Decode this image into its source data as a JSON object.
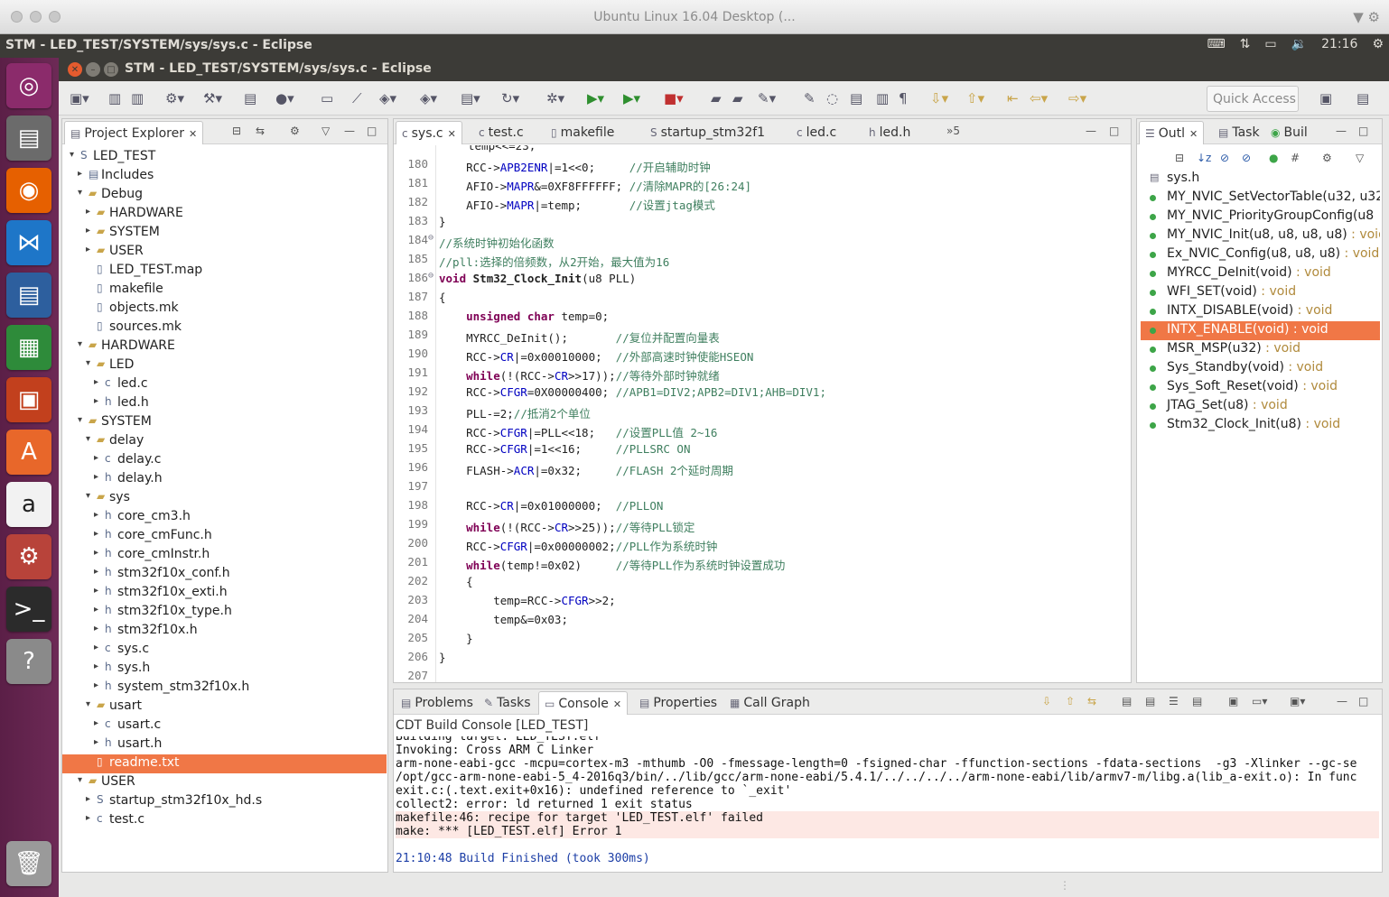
{
  "vm": {
    "title": "Ubuntu Linux 16.04 Desktop (...",
    "right_icons": "▼ ⚙"
  },
  "topbar": {
    "app_title": "STM - LED_TEST/SYSTEM/sys/sys.c - Eclipse",
    "clock": "21:16"
  },
  "window": {
    "title": "STM - LED_TEST/SYSTEM/sys/sys.c - Eclipse",
    "quick_access": "Quick Access"
  },
  "explorer": {
    "tab_label": "Project Explorer",
    "rows": [
      {
        "label": "LED_TEST",
        "depth": 0,
        "arrow": "▾",
        "icon": "S"
      },
      {
        "label": "Includes",
        "depth": 1,
        "arrow": "▸",
        "icon": "▤"
      },
      {
        "label": "Debug",
        "depth": 1,
        "arrow": "▾",
        "icon": "▰"
      },
      {
        "label": "HARDWARE",
        "depth": 2,
        "arrow": "▸",
        "icon": "▰"
      },
      {
        "label": "SYSTEM",
        "depth": 2,
        "arrow": "▸",
        "icon": "▰"
      },
      {
        "label": "USER",
        "depth": 2,
        "arrow": "▸",
        "icon": "▰"
      },
      {
        "label": "LED_TEST.map",
        "depth": 2,
        "arrow": "",
        "icon": "▯"
      },
      {
        "label": "makefile",
        "depth": 2,
        "arrow": "",
        "icon": "▯"
      },
      {
        "label": "objects.mk",
        "depth": 2,
        "arrow": "",
        "icon": "▯"
      },
      {
        "label": "sources.mk",
        "depth": 2,
        "arrow": "",
        "icon": "▯"
      },
      {
        "label": "HARDWARE",
        "depth": 1,
        "arrow": "▾",
        "icon": "▰"
      },
      {
        "label": "LED",
        "depth": 2,
        "arrow": "▾",
        "icon": "▰"
      },
      {
        "label": "led.c",
        "depth": 3,
        "arrow": "▸",
        "icon": "c"
      },
      {
        "label": "led.h",
        "depth": 3,
        "arrow": "▸",
        "icon": "h"
      },
      {
        "label": "SYSTEM",
        "depth": 1,
        "arrow": "▾",
        "icon": "▰"
      },
      {
        "label": "delay",
        "depth": 2,
        "arrow": "▾",
        "icon": "▰"
      },
      {
        "label": "delay.c",
        "depth": 3,
        "arrow": "▸",
        "icon": "c"
      },
      {
        "label": "delay.h",
        "depth": 3,
        "arrow": "▸",
        "icon": "h"
      },
      {
        "label": "sys",
        "depth": 2,
        "arrow": "▾",
        "icon": "▰"
      },
      {
        "label": "core_cm3.h",
        "depth": 3,
        "arrow": "▸",
        "icon": "h"
      },
      {
        "label": "core_cmFunc.h",
        "depth": 3,
        "arrow": "▸",
        "icon": "h"
      },
      {
        "label": "core_cmInstr.h",
        "depth": 3,
        "arrow": "▸",
        "icon": "h"
      },
      {
        "label": "stm32f10x_conf.h",
        "depth": 3,
        "arrow": "▸",
        "icon": "h"
      },
      {
        "label": "stm32f10x_exti.h",
        "depth": 3,
        "arrow": "▸",
        "icon": "h"
      },
      {
        "label": "stm32f10x_type.h",
        "depth": 3,
        "arrow": "▸",
        "icon": "h"
      },
      {
        "label": "stm32f10x.h",
        "depth": 3,
        "arrow": "▸",
        "icon": "h"
      },
      {
        "label": "sys.c",
        "depth": 3,
        "arrow": "▸",
        "icon": "c"
      },
      {
        "label": "sys.h",
        "depth": 3,
        "arrow": "▸",
        "icon": "h"
      },
      {
        "label": "system_stm32f10x.h",
        "depth": 3,
        "arrow": "▸",
        "icon": "h"
      },
      {
        "label": "usart",
        "depth": 2,
        "arrow": "▾",
        "icon": "▰"
      },
      {
        "label": "usart.c",
        "depth": 3,
        "arrow": "▸",
        "icon": "c"
      },
      {
        "label": "usart.h",
        "depth": 3,
        "arrow": "▸",
        "icon": "h"
      },
      {
        "label": "readme.txt",
        "depth": 2,
        "arrow": "",
        "icon": "▯",
        "selected": true
      },
      {
        "label": "USER",
        "depth": 1,
        "arrow": "▾",
        "icon": "▰"
      },
      {
        "label": "startup_stm32f10x_hd.s",
        "depth": 2,
        "arrow": "▸",
        "icon": "S"
      },
      {
        "label": "test.c",
        "depth": 2,
        "arrow": "▸",
        "icon": "c"
      }
    ]
  },
  "editor": {
    "tabs": [
      "sys.c",
      "test.c",
      "makefile",
      "startup_stm32f1",
      "led.c",
      "led.h"
    ],
    "tabs_overflow": "»5",
    "partial_top": "temp<<=23;",
    "lines": [
      {
        "n": "180",
        "html": "    RCC-><span class=\"fld\">APB2ENR</span>|=1<<0;     <span class=\"cm\">//开启辅助时钟</span>"
      },
      {
        "n": "181",
        "html": "    AFIO-><span class=\"fld\">MAPR</span>&=0XF8FFFFFF; <span class=\"cm\">//清除MAPR的[26:24]</span>"
      },
      {
        "n": "182",
        "html": "    AFIO-><span class=\"fld\">MAPR</span>|=temp;       <span class=\"cm\">//设置jtag模式</span>"
      },
      {
        "n": "183",
        "html": "}"
      },
      {
        "n": "184",
        "fold": true,
        "html": "<span class=\"cm\">//系统时钟初始化函数</span>"
      },
      {
        "n": "185",
        "html": "<span class=\"cm\">//pll:选择的倍频数，从2开始，最大值为16</span>"
      },
      {
        "n": "186",
        "fold": true,
        "html": "<span class=\"kw\">void</span> <span class=\"bold\">Stm32_Clock_Init</span>(u8 PLL)"
      },
      {
        "n": "187",
        "html": "{"
      },
      {
        "n": "188",
        "html": "    <span class=\"kw\">unsigned char</span> temp=0;"
      },
      {
        "n": "189",
        "html": "    MYRCC_DeInit();       <span class=\"cm\">//复位并配置向量表</span>"
      },
      {
        "n": "190",
        "html": "    RCC-><span class=\"fld\">CR</span>|=0x00010000;  <span class=\"cm\">//外部高速时钟使能HSEON</span>"
      },
      {
        "n": "191",
        "html": "    <span class=\"kw\">while</span>(!(RCC-><span class=\"fld\">CR</span>>>17));<span class=\"cm\">//等待外部时钟就绪</span>"
      },
      {
        "n": "192",
        "html": "    RCC-><span class=\"fld\">CFGR</span>=0X00000400; <span class=\"cm\">//APB1=DIV2;APB2=DIV1;AHB=DIV1;</span>"
      },
      {
        "n": "193",
        "html": "    PLL-=2;<span class=\"cm\">//抵消2个单位</span>"
      },
      {
        "n": "194",
        "html": "    RCC-><span class=\"fld\">CFGR</span>|=PLL<<18;   <span class=\"cm\">//设置PLL值 2~16</span>"
      },
      {
        "n": "195",
        "html": "    RCC-><span class=\"fld\">CFGR</span>|=1<<16;     <span class=\"cm\">//PLLSRC ON</span>"
      },
      {
        "n": "196",
        "html": "    FLASH-><span class=\"fld\">ACR</span>|=0x32;     <span class=\"cm\">//FLASH 2个延时周期</span>"
      },
      {
        "n": "197",
        "html": ""
      },
      {
        "n": "198",
        "html": "    RCC-><span class=\"fld\">CR</span>|=0x01000000;  <span class=\"cm\">//PLLON</span>"
      },
      {
        "n": "199",
        "html": "    <span class=\"kw\">while</span>(!(RCC-><span class=\"fld\">CR</span>>>25));<span class=\"cm\">//等待PLL锁定</span>"
      },
      {
        "n": "200",
        "html": "    RCC-><span class=\"fld\">CFGR</span>|=0x00000002;<span class=\"cm\">//PLL作为系统时钟</span>"
      },
      {
        "n": "201",
        "html": "    <span class=\"kw\">while</span>(temp!=0x02)     <span class=\"cm\">//等待PLL作为系统时钟设置成功</span>"
      },
      {
        "n": "202",
        "html": "    {"
      },
      {
        "n": "203",
        "html": "        temp=RCC-><span class=\"fld\">CFGR</span>>>2;"
      },
      {
        "n": "204",
        "html": "        temp&=0x03;"
      },
      {
        "n": "205",
        "html": "    }"
      },
      {
        "n": "206",
        "html": "}"
      },
      {
        "n": "207",
        "html": ""
      }
    ]
  },
  "outline": {
    "tabs": [
      "Outl",
      "Task",
      "Buil"
    ],
    "header": "sys.h",
    "items": [
      {
        "name": "MY_NVIC_SetVectorTable(u32, u32",
        "type": ""
      },
      {
        "name": "MY_NVIC_PriorityGroupConfig(u8",
        "type": ""
      },
      {
        "name": "MY_NVIC_Init(u8, u8, u8, u8)",
        "type": " : void"
      },
      {
        "name": "Ex_NVIC_Config(u8, u8, u8)",
        "type": " : void"
      },
      {
        "name": "MYRCC_DeInit(void)",
        "type": " : void"
      },
      {
        "name": "WFI_SET(void)",
        "type": " : void"
      },
      {
        "name": "INTX_DISABLE(void)",
        "type": " : void"
      },
      {
        "name": "INTX_ENABLE(void)",
        "type": " : void",
        "selected": true
      },
      {
        "name": "MSR_MSP(u32)",
        "type": " : void"
      },
      {
        "name": "Sys_Standby(void)",
        "type": " : void"
      },
      {
        "name": "Sys_Soft_Reset(void)",
        "type": " : void"
      },
      {
        "name": "JTAG_Set(u8)",
        "type": " : void"
      },
      {
        "name": "Stm32_Clock_Init(u8)",
        "type": " : void"
      }
    ]
  },
  "console": {
    "tabs": [
      "Problems",
      "Tasks",
      "Console",
      "Properties",
      "Call Graph"
    ],
    "header": "CDT Build Console [LED_TEST]",
    "lines": [
      {
        "text": "Building target: LED_TEST.elf",
        "kind": "partial"
      },
      {
        "text": "Invoking: Cross ARM C Linker",
        "kind": ""
      },
      {
        "text": "arm-none-eabi-gcc -mcpu=cortex-m3 -mthumb -O0 -fmessage-length=0 -fsigned-char -ffunction-sections -fdata-sections  -g3 -Xlinker --gc-se",
        "kind": ""
      },
      {
        "text": "/opt/gcc-arm-none-eabi-5_4-2016q3/bin/../lib/gcc/arm-none-eabi/5.4.1/../../../../arm-none-eabi/lib/armv7-m/libg.a(lib_a-exit.o): In func",
        "kind": ""
      },
      {
        "text": "exit.c:(.text.exit+0x16): undefined reference to `_exit'",
        "kind": ""
      },
      {
        "text": "collect2: error: ld returned 1 exit status",
        "kind": ""
      },
      {
        "text": "makefile:46: recipe for target 'LED_TEST.elf' failed",
        "kind": "err"
      },
      {
        "text": "make: *** [LED_TEST.elf] Error 1",
        "kind": "err"
      },
      {
        "text": "",
        "kind": ""
      },
      {
        "text": "21:10:48 Build Finished (took 300ms)",
        "kind": "fin"
      }
    ]
  }
}
